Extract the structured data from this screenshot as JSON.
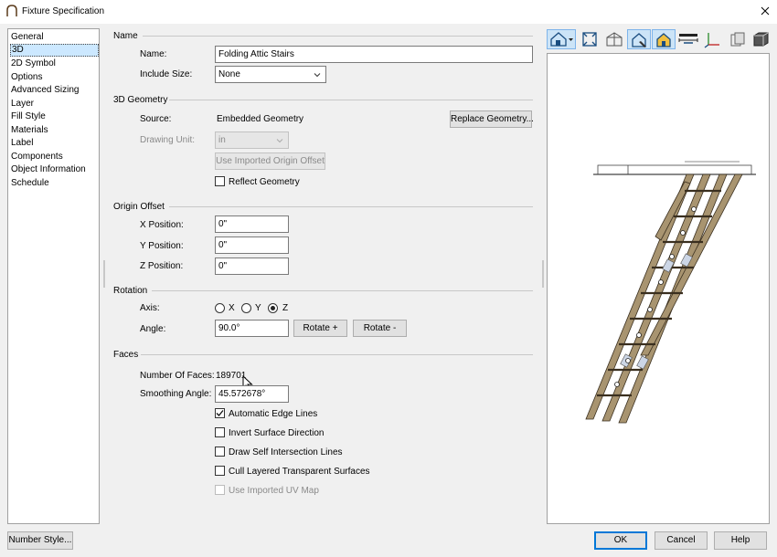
{
  "window": {
    "title": "Fixture Specification"
  },
  "sidebar": {
    "items": [
      {
        "label": "General"
      },
      {
        "label": "3D"
      },
      {
        "label": "2D Symbol"
      },
      {
        "label": "Options"
      },
      {
        "label": "Advanced Sizing"
      },
      {
        "label": "Layer"
      },
      {
        "label": "Fill Style"
      },
      {
        "label": "Materials"
      },
      {
        "label": "Label"
      },
      {
        "label": "Components"
      },
      {
        "label": "Object Information"
      },
      {
        "label": "Schedule"
      }
    ],
    "selected_index": 1
  },
  "name_group": {
    "heading": "Name",
    "name_label": "Name:",
    "name_value": "Folding Attic Stairs",
    "include_size_label": "Include Size:",
    "include_size_value": "None"
  },
  "geometry_group": {
    "heading": "3D Geometry",
    "source_label": "Source:",
    "source_value": "Embedded Geometry",
    "replace_button": "Replace Geometry...",
    "drawing_unit_label": "Drawing Unit:",
    "drawing_unit_value": "in",
    "origin_offset_button": "Use Imported Origin Offset",
    "reflect_label": "Reflect Geometry",
    "reflect_checked": false
  },
  "origin_group": {
    "heading": "Origin Offset",
    "x_label": "X Position:",
    "x_value": "0\"",
    "y_label": "Y Position:",
    "y_value": "0\"",
    "z_label": "Z Position:",
    "z_value": "0\""
  },
  "rotation_group": {
    "heading": "Rotation",
    "axis_label": "Axis:",
    "axis_options": [
      "X",
      "Y",
      "Z"
    ],
    "axis_selected": "Z",
    "angle_label": "Angle:",
    "angle_value": "90.0°",
    "rotate_plus": "Rotate +",
    "rotate_minus": "Rotate -"
  },
  "faces_group": {
    "heading": "Faces",
    "num_faces_label": "Number Of Faces:",
    "num_faces_value": "189701",
    "smoothing_label": "Smoothing Angle:",
    "smoothing_value": "45.572678°",
    "auto_edge_label": "Automatic Edge Lines",
    "auto_edge_checked": true,
    "invert_label": "Invert Surface Direction",
    "invert_checked": false,
    "self_intersect_label": "Draw Self Intersection Lines",
    "self_intersect_checked": false,
    "cull_label": "Cull Layered Transparent Surfaces",
    "cull_checked": false,
    "uv_label": "Use Imported UV Map",
    "uv_checked": false
  },
  "footer": {
    "number_style": "Number Style...",
    "ok": "OK",
    "cancel": "Cancel",
    "help": "Help"
  },
  "toolbar": {
    "icons": [
      "camera-view-icon",
      "fit-view-icon",
      "wireframe-view-icon",
      "edge-view-icon",
      "color-view-icon",
      "dimension-icon",
      "axes-icon",
      "transparency-icon",
      "solid-box-icon"
    ]
  },
  "colors": {
    "accent": "#0078d7",
    "selection": "#cce8ff",
    "wood": "#a89470"
  }
}
